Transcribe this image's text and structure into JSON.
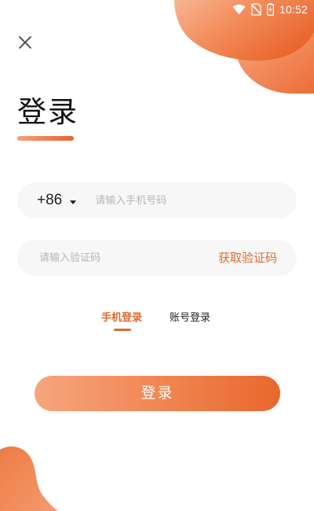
{
  "status_bar": {
    "time": "10:52",
    "icons": [
      "wifi-icon",
      "no-sim-icon",
      "battery-charging-icon"
    ]
  },
  "header": {
    "close_icon": "close-icon",
    "title": "登录"
  },
  "form": {
    "country_code": "+86",
    "phone_placeholder": "请输入手机号码",
    "code_placeholder": "请输入验证码",
    "get_code_label": "获取验证码"
  },
  "tabs": [
    {
      "label": "手机登录",
      "active": true
    },
    {
      "label": "账号登录",
      "active": false
    }
  ],
  "login_button_label": "登录",
  "colors": {
    "accent": "#e06a2e",
    "accent_light": "#f7a57f",
    "field_bg": "#f7f7f7",
    "placeholder": "#b6b6b6"
  }
}
